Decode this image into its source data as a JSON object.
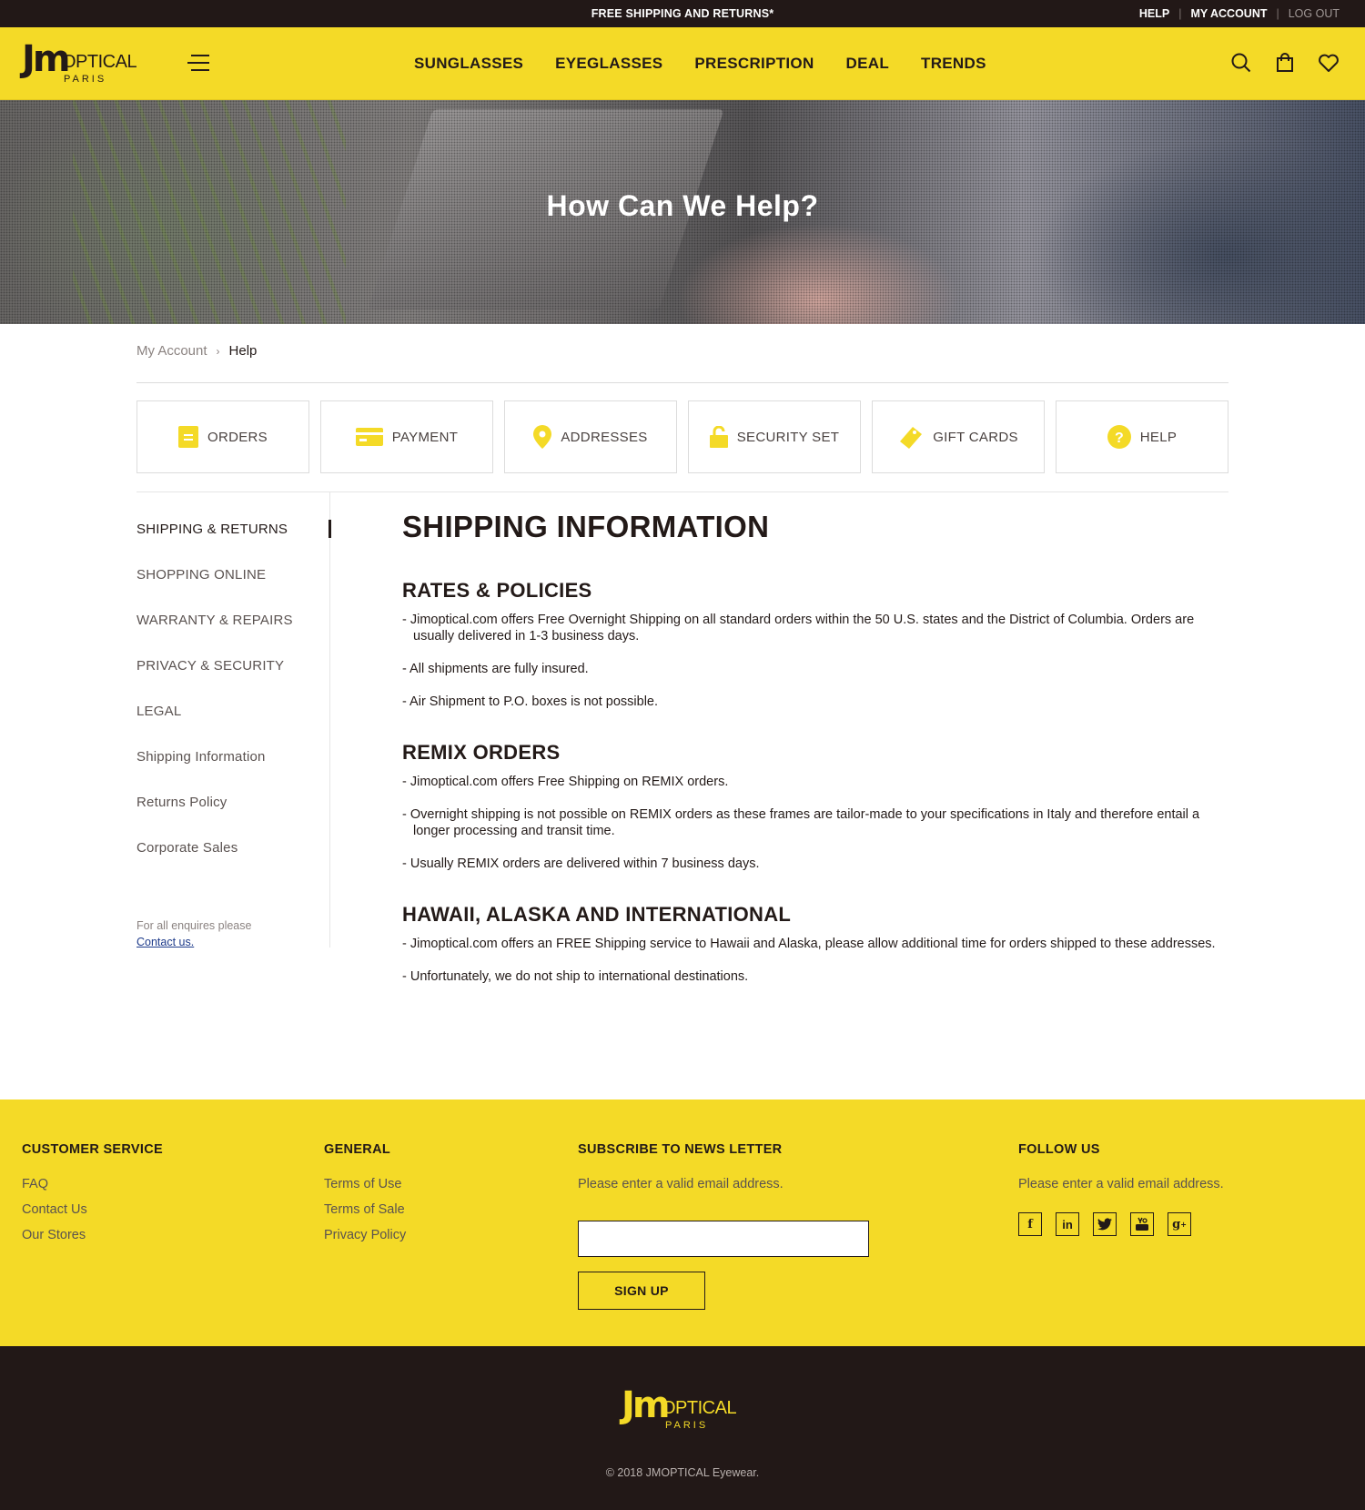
{
  "topbar": {
    "promo": "FREE SHIPPING AND RETURNS*",
    "help": "HELP",
    "my_account": "MY ACCOUNT",
    "logout": "LOG OUT"
  },
  "brand": {
    "mark": "Jm",
    "name": "OPTICAL",
    "sub": "PARIS"
  },
  "nav": [
    "SUNGLASSES",
    "EYEGLASSES",
    "PRESCRIPTION",
    "DEAL",
    "TRENDS"
  ],
  "hero": {
    "title": "How Can We Help?"
  },
  "breadcrumb": {
    "parent": "My Account",
    "current": "Help"
  },
  "tabs": [
    {
      "label": "ORDERS",
      "icon": "orders-icon"
    },
    {
      "label": "PAYMENT",
      "icon": "credit-card-icon"
    },
    {
      "label": "ADDRESSES",
      "icon": "map-pin-icon"
    },
    {
      "label": "SECURITY SET",
      "icon": "lock-icon"
    },
    {
      "label": "GIFT CARDS",
      "icon": "gift-tag-icon"
    },
    {
      "label": "HELP",
      "icon": "question-icon"
    }
  ],
  "sidebar": {
    "items": [
      "SHIPPING & RETURNS",
      "SHOPPING ONLINE",
      "WARRANTY & REPAIRS",
      "PRIVACY & SECURITY",
      "LEGAL",
      "Shipping Information",
      "Returns Policy",
      "Corporate Sales"
    ],
    "enquiry": "For all enquires please",
    "contact": "Contact us."
  },
  "article": {
    "title": "SHIPPING INFORMATION",
    "sections": [
      {
        "heading": "RATES & POLICIES",
        "items": [
          "- Jimoptical.com offers Free Overnight Shipping on all standard orders within the 50 U.S. states and the District of Columbia. Orders are usually delivered in 1-3 business days.",
          "- All shipments are fully insured.",
          "- Air Shipment to P.O. boxes is not possible."
        ]
      },
      {
        "heading": "REMIX ORDERS",
        "items": [
          "- Jimoptical.com offers Free Shipping on REMIX orders.",
          "- Overnight shipping is not possible on REMIX orders as these frames are tailor-made to your specifications in Italy and therefore entail a longer processing and transit time.",
          "- Usually REMIX orders are delivered within 7 business days."
        ]
      },
      {
        "heading": "HAWAII, ALASKA AND INTERNATIONAL",
        "items": [
          "- Jimoptical.com offers an FREE Shipping service to Hawaii and Alaska, please allow additional time for orders shipped to these addresses.",
          "- Unfortunately, we do not ship to international destinations."
        ]
      }
    ]
  },
  "footer": {
    "customer_service": {
      "title": "CUSTOMER SERVICE",
      "links": [
        "FAQ",
        "Contact Us",
        "Our Stores"
      ]
    },
    "general": {
      "title": "GENERAL",
      "links": [
        "Terms of Use",
        "Terms of Sale",
        "Privacy Policy"
      ]
    },
    "newsletter": {
      "title": "SUBSCRIBE TO NEWS LETTER",
      "note": "Please enter a valid email address.",
      "email_value": "",
      "signup": "SIGN UP"
    },
    "follow": {
      "title": "FOLLOW US",
      "note": "Please enter a valid email address.",
      "icons": [
        "facebook-icon",
        "linkedin-icon",
        "twitter-icon",
        "youtube-icon",
        "google-plus-icon"
      ]
    }
  },
  "copyright": "© 2018 JMOPTICAL Eyewear.",
  "colors": {
    "accent": "#f4da27",
    "dark": "#221817"
  }
}
